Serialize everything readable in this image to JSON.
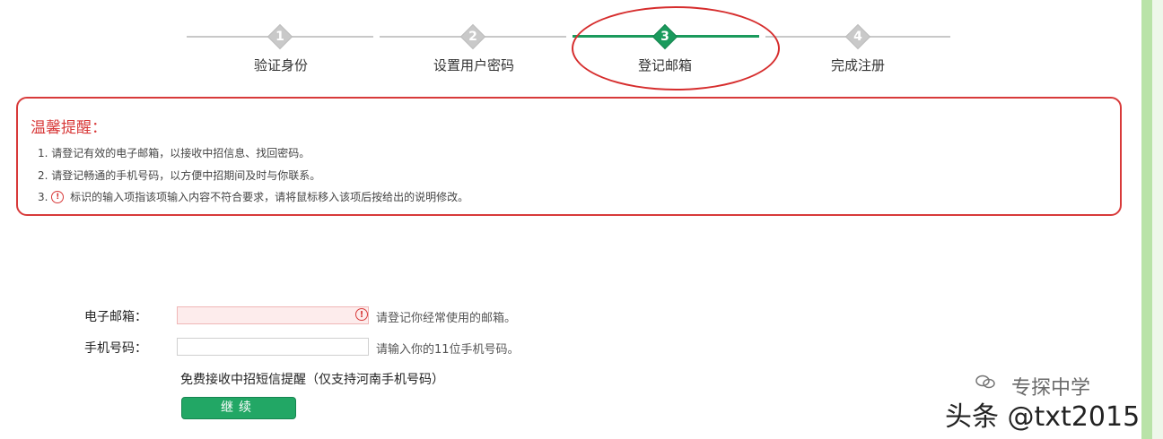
{
  "stepper": {
    "steps": [
      {
        "number": "1",
        "label": "验证身份",
        "state": "done"
      },
      {
        "number": "2",
        "label": "设置用户密码",
        "state": "done"
      },
      {
        "number": "3",
        "label": "登记邮箱",
        "state": "current"
      },
      {
        "number": "4",
        "label": "完成注册",
        "state": "todo"
      }
    ],
    "active_color": "#1a9a5c",
    "inactive_color": "#c9c9c9"
  },
  "tips": {
    "title": "温馨提醒：",
    "items": [
      "1. 请登记有效的电子邮箱，以接收中招信息、找回密码。",
      "2. 请登记畅通的手机号码，以方便中招期间及时与你联系。",
      "3.",
      "标识的输入项指该项输入内容不符合要求，请将鼠标移入该项后按给出的说明修改。"
    ],
    "border_color": "#d83a3a"
  },
  "form": {
    "email_label": "电子邮箱：",
    "email_value": "",
    "email_hint": "请登记你经常使用的邮箱。",
    "phone_label": "手机号码：",
    "phone_value": "",
    "phone_hint": "请输入你的11位手机号码。",
    "sms_notice": "免费接收中招短信提醒（仅支持河南手机号码）",
    "continue_label": "继续",
    "error_icon": "!"
  },
  "watermark": {
    "line1": "专探中学",
    "line2": "头条 @txt2015"
  }
}
